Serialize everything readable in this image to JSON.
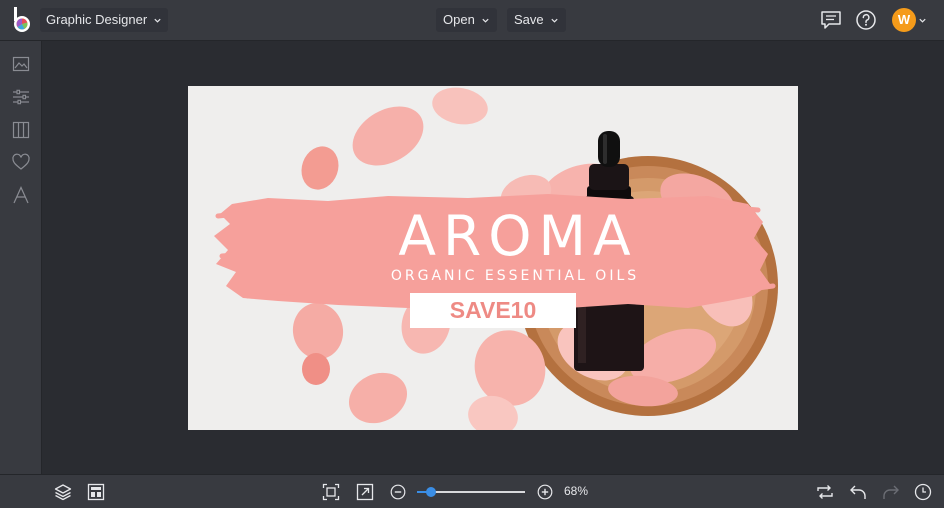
{
  "app": {
    "mode_label": "Graphic Designer",
    "avatar_initial": "W"
  },
  "menu": {
    "open_label": "Open",
    "save_label": "Save"
  },
  "top_icons": [
    "comments-icon",
    "help-icon"
  ],
  "rail_icons": [
    "image-icon",
    "adjust-icon",
    "columns-icon",
    "heart-icon",
    "text-icon"
  ],
  "design": {
    "headline": "AROMA",
    "subheadline": "ORGANIC ESSENTIAL OILS",
    "promo_code": "SAVE10",
    "brush_color": "#f6a09b",
    "promo_text_color": "#ee8a84"
  },
  "bottom": {
    "zoom_label": "68%",
    "zoom_level": 0.13
  },
  "colors": {
    "topbar": "#383a40",
    "workspace": "#2a2c31",
    "accent": "#3a8ee6",
    "avatar": "#f59b1a"
  }
}
